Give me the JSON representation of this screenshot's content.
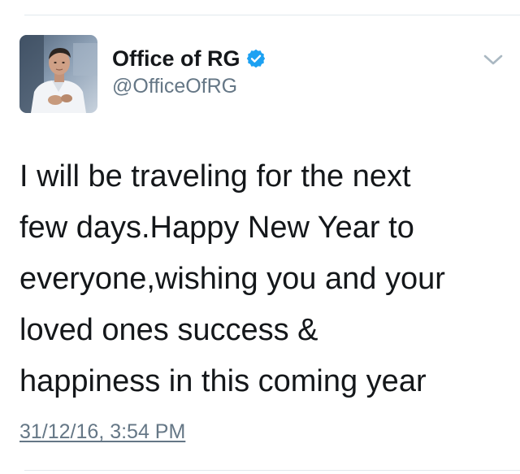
{
  "tweet": {
    "author": {
      "display_name": "Office of RG",
      "handle": "@OfficeOfRG",
      "verified": true,
      "avatar_icon": "profile-photo"
    },
    "text_lines": [
      "I will be traveling for the next",
      "few days.Happy New Year to",
      "everyone,wishing you and your",
      "loved ones success &",
      "happiness in this coming year"
    ],
    "timestamp": "31/12/16, 3:54 PM"
  },
  "icons": {
    "verified": "verified-badge-icon",
    "menu": "chevron-down-icon"
  },
  "colors": {
    "text_primary": "#14171a",
    "text_secondary": "#657786",
    "verified_blue": "#1da1f2",
    "divider": "#e1e8ed"
  }
}
